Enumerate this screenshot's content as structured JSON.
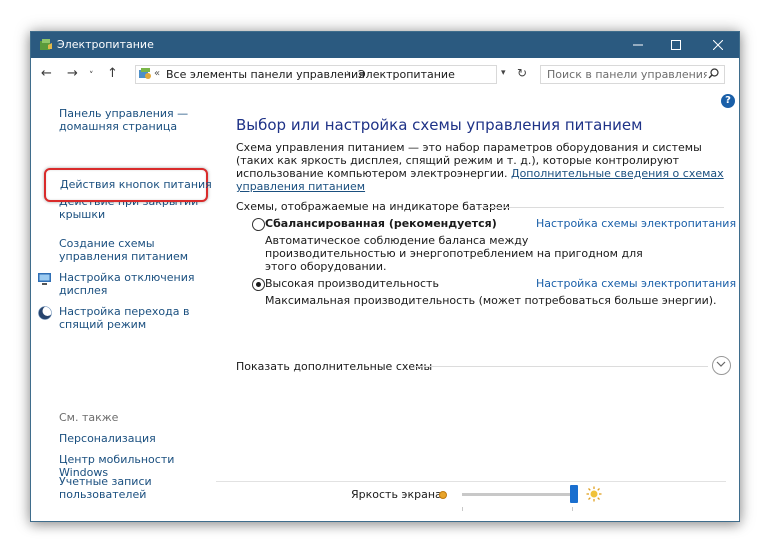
{
  "window": {
    "title": "Электропитание",
    "accent": "#2b5a80"
  },
  "address": {
    "breadcrumbs": [
      "Все элементы панели управления",
      "Электропитание"
    ],
    "search_placeholder": "Поиск в панели управления"
  },
  "sidebar": {
    "items": [
      {
        "label": "Панель управления — домашняя страница"
      },
      {
        "label": "Действия кнопок питания",
        "highlighted": true
      },
      {
        "label": "Действие при закрытии крышки"
      },
      {
        "label": "Создание схемы управления питанием"
      },
      {
        "label": "Настройка отключения дисплея"
      },
      {
        "label": "Настройка перехода в спящий режим"
      }
    ],
    "see_also_title": "См. также",
    "see_also": [
      {
        "label": "Персонализация"
      },
      {
        "label": "Центр мобильности Windows"
      },
      {
        "label": "Учетные записи пользователей"
      }
    ]
  },
  "main": {
    "title": "Выбор или настройка схемы управления питанием",
    "description": "Схема управления питанием — это набор параметров оборудования и системы (таких как яркость дисплея, спящий режим и т. д.), которые контролируют использование компьютером электроэнергии.",
    "description_link": "Дополнительные сведения о схемах управления питанием",
    "group_title": "Схемы, отображаемые на индикаторе батареи",
    "plans": [
      {
        "name": "Сбалансированная (рекомендуется)",
        "selected": false,
        "link": "Настройка схемы электропитания",
        "description": "Автоматическое соблюдение баланса между производительностью и энергопотреблением на пригодном для этого оборудовании."
      },
      {
        "name": "Высокая производительность",
        "selected": true,
        "link": "Настройка схемы электропитания",
        "description": "Максимальная производительность (может потребоваться больше энергии)."
      }
    ],
    "show_more": "Показать дополнительные схемы"
  },
  "brightness": {
    "label": "Яркость экрана:",
    "level": 1.0
  },
  "colors": {
    "link": "#1a4f7f",
    "heading": "#1e3287",
    "highlight_border": "#d92b2b",
    "slider": "#1a6fcf"
  }
}
